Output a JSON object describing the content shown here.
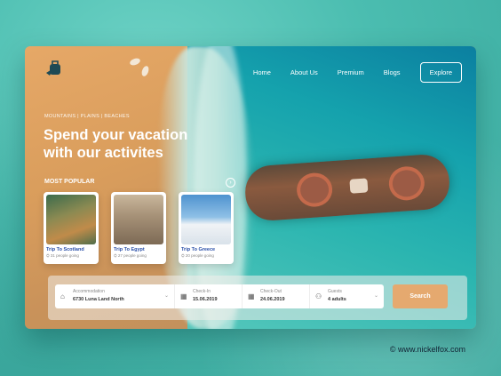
{
  "nav": {
    "items": [
      "Home",
      "About Us",
      "Premium",
      "Blogs"
    ],
    "cta": "Explore"
  },
  "hero": {
    "breadcrumb": "MOUNTAINS  |  PLAINS  |  BEACHES",
    "headline_line1": "Spend your vacation",
    "headline_line2": "with our activites"
  },
  "popular": {
    "title": "MOST POPULAR",
    "trips": [
      {
        "title": "Trip To Scotland",
        "people": "31 people going"
      },
      {
        "title": "Trip To Egypt",
        "people": "27 people going"
      },
      {
        "title": "Trip To Greece",
        "people": "20 people going"
      }
    ]
  },
  "search": {
    "accommodation_label": "Accommodation",
    "accommodation_value": "6730 Luna Land North",
    "checkin_label": "Check-In",
    "checkin_value": "15.06.2019",
    "checkout_label": "Check-Out",
    "checkout_value": "24.06.2019",
    "guests_label": "Guests",
    "guests_value": "4 adults",
    "button": "Search"
  },
  "credit": "© www.nickelfox.com",
  "colors": {
    "sand": "#d99d5c",
    "sea": "#15a2ad",
    "accent": "#e5a96f",
    "trip_title": "#2a4fa8"
  }
}
